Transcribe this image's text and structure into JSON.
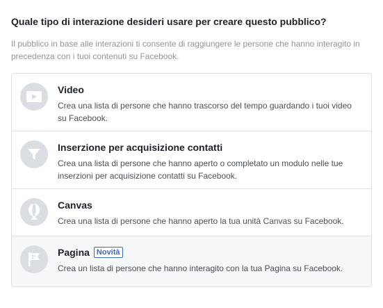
{
  "header": {
    "title": "Quale tipo di interazione desideri usare per creare questo pubblico?",
    "description": "Il pubblico in base alle interazioni ti consente di raggiungere le persone che hanno interagito in precedenza con i tuoi contenuti su Facebook."
  },
  "options": [
    {
      "title": "Video",
      "description": "Crea una lista di persone che hanno trascorso del tempo guardando i tuoi video su Facebook.",
      "icon": "video-icon"
    },
    {
      "title": "Inserzione per acquisizione contatti",
      "description": "Crea una lista di persone che hanno aperto o completato un modulo nelle tue inserzioni per acquisizione contatti su Facebook.",
      "icon": "funnel-icon"
    },
    {
      "title": "Canvas",
      "description": "Crea una lista di persone che hanno aperto la tua unità Canvas su Facebook.",
      "icon": "canvas-icon"
    },
    {
      "title": "Pagina",
      "badge": "Novità",
      "description": "Crea un lista di persone che hanno interagito con la tua Pagina su Facebook.",
      "icon": "flag-icon"
    }
  ],
  "colors": {
    "icon_bg": "#dadde1",
    "icon_fg": "#ffffff",
    "badge": "#4267b2",
    "hover_bg": "#f6f7f9"
  }
}
